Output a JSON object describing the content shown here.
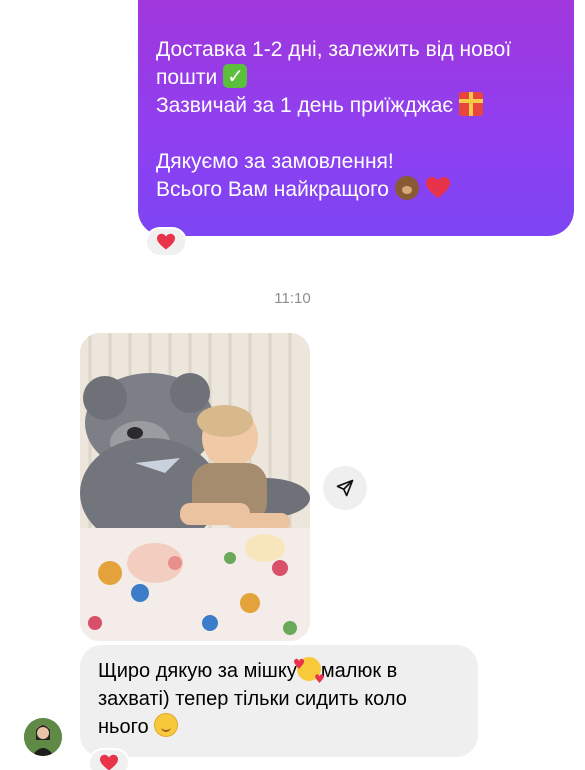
{
  "sent_message": {
    "line1": "Доставка 1-2 дні, залежить від нової",
    "line2": "пошти",
    "line3": "Зазвичай за 1 день приїжджає",
    "line4": "Дякуємо за замовлення!",
    "line5": "Всього Вам найкращого"
  },
  "timestamp": "11:10",
  "received_message": {
    "line1_part1": "Щиро дякую за мішку",
    "line1_part2": "малюк в",
    "line2": "захваті) тепер тільки сидить коло",
    "line3": "нього"
  },
  "icons": {
    "check": "check-mark-emoji-icon",
    "gift": "gift-emoji-icon",
    "bear": "bear-emoji-icon",
    "heart": "red-heart-emoji-icon",
    "smiling_love": "smiling-face-with-hearts-emoji-icon",
    "relieved": "smiling-face-emoji-icon",
    "share": "share-arrow-icon"
  },
  "colors": {
    "sent_bubble": "#9a3be6",
    "received_bubble": "#efefef",
    "reaction_heart": "#e8334a",
    "timestamp": "#8e8e8e"
  }
}
